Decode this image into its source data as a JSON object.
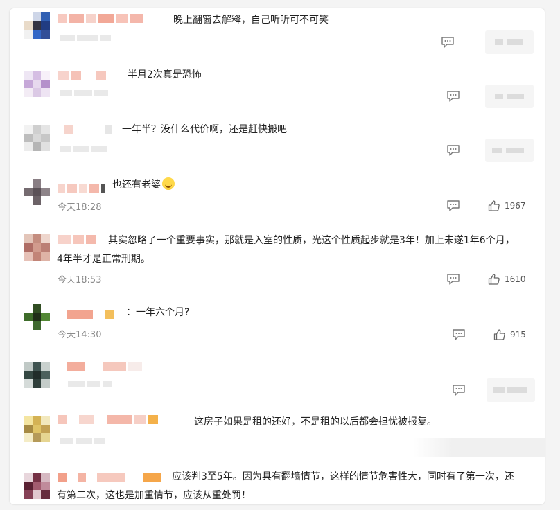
{
  "comments": [
    {
      "text": "晚上翻窗去解释，自己听听可不可笑",
      "time": "",
      "likes": "",
      "avatar": [
        "#fff",
        "#cdd6ea",
        "#2b5fbd",
        "#eadbc7",
        "#334",
        "#1e3c8a",
        "#f1f1f1",
        "#2e67d1",
        "#2f4e9f"
      ]
    },
    {
      "text": "半月2次真是恐怖",
      "time": "",
      "likes": "",
      "avatar": [
        "#efe6f5",
        "#d7bde6",
        "#f7f0fa",
        "#c8a7dc",
        "#e8d9f0",
        "#b890d0",
        "#f3ecf6",
        "#dcc8e8",
        "#efe4f4"
      ]
    },
    {
      "text": "一年半？没什么代价啊，还是赶快搬吧",
      "time": "",
      "likes": "",
      "avatar": [
        "#f2f2f2",
        "#cfcfcf",
        "#e5e5e5",
        "#bdbdbd",
        "#d8d8d8",
        "#c7c7c7",
        "#ececec",
        "#b5b5b5",
        "#e0e0e0"
      ]
    },
    {
      "text": "也还有老婆",
      "time": "今天18:28",
      "likes": "1967",
      "avatar": [
        "#fff",
        "#8a7e84",
        "#fff",
        "#766b70",
        "#5c5157",
        "#8f8489",
        "#fff",
        "#6d6267",
        "#fff"
      ]
    },
    {
      "text": "其实忽略了一个重要事实，那就是入室的性质，光这个性质起步就是3年！加上未遂1年6个月，4年半才是正常刑期。",
      "time": "今天18:53",
      "likes": "1610",
      "avatar": [
        "#e6c4b7",
        "#c98c7c",
        "#f0d6cb",
        "#b56b63",
        "#d69a8a",
        "#c07e72",
        "#e9c0b5",
        "#c78374",
        "#e2b2a4"
      ]
    },
    {
      "text": "：一年六个月?",
      "time": "今天14:30",
      "likes": "915",
      "avatar": [
        "#fff",
        "#2f4f1f",
        "#fff",
        "#3b6e24",
        "#1f2e16",
        "#4f8a2e",
        "#fff",
        "#3c6a2a",
        "#fff"
      ]
    },
    {
      "text": "",
      "time": "",
      "likes": "",
      "avatar": [
        "#bfc9c6",
        "#3e5451",
        "#c8d1ce",
        "#324742",
        "#1f2c29",
        "#4a615c",
        "#d4dbd9",
        "#2e3f3b",
        "#c3ccc9"
      ]
    },
    {
      "text": "这房子如果是租的还好，不是租的以后都会担忧被报复。",
      "time": "",
      "likes": "",
      "avatar": [
        "#f6e59a",
        "#d8b24a",
        "#f3e8b8",
        "#a98a3b",
        "#e2c35c",
        "#c7a14a",
        "#f5ecc2",
        "#b89a52",
        "#e8d58a"
      ]
    },
    {
      "text": "应该判3至5年。因为具有翻墙情节，这样的情节危害性大，同时有了第一次，还有第二次，这也是加重情节，应该从重处罚！",
      "time": "",
      "likes": "",
      "avatar": [
        "#e9d6dc",
        "#7b2f45",
        "#d9b8c2",
        "#5e1f33",
        "#a8596f",
        "#c48a9b",
        "#8c3f56",
        "#e3c7cf",
        "#6b2a3d"
      ]
    }
  ]
}
